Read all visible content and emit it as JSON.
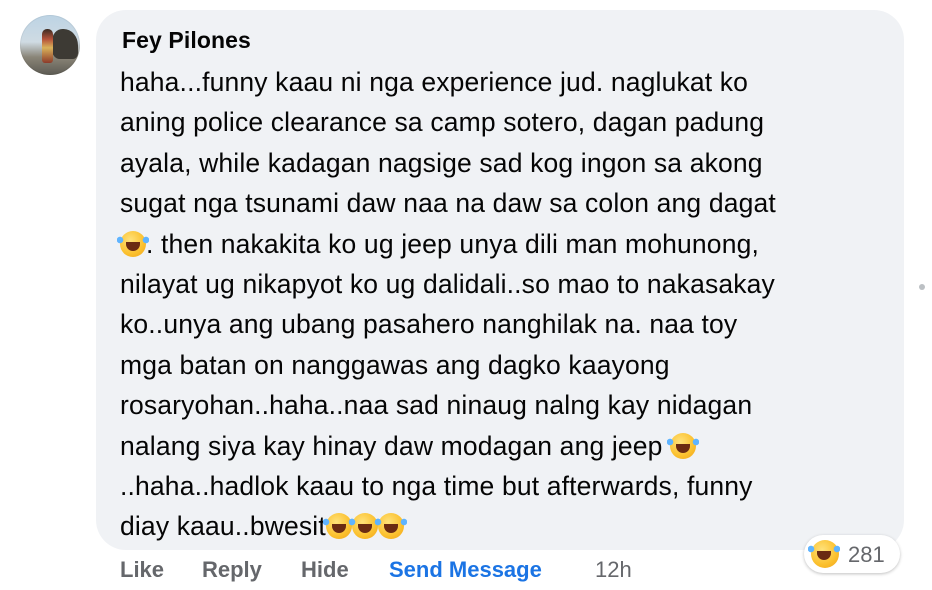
{
  "comment": {
    "author": "Fey Pilones",
    "lines": [
      "haha...funny kaau ni nga experience jud. naglukat ko",
      "aning police clearance sa camp sotero, dagan padung",
      "ayala, while kadagan nagsige sad kog ingon sa akong",
      "sugat nga tsunami daw naa na daw sa colon ang dagat",
      ". then nakakita ko ug jeep unya dili man mohunong,",
      "nilayat ug nikapyot ko ug dalidali..so mao to nakasakay",
      "ko..unya ang ubang pasahero nanghilak na. naa toy",
      "mga batan on nanggawas ang dagko kaayong",
      "rosaryohan..haha..naa sad ninaug nalng kay nidagan",
      "nalang siya kay hinay daw modagan ang jeep",
      "..haha..hadlok kaau to nga time but afterwards, funny",
      "diay kaau..bwesit"
    ],
    "emoji": "face-with-tears-of-joy-icon"
  },
  "reactions": {
    "count": "281",
    "icon": "haha-reaction-icon"
  },
  "actions": {
    "like": "Like",
    "reply": "Reply",
    "hide": "Hide",
    "send_message": "Send Message",
    "timestamp": "12h"
  },
  "colors": {
    "bubble": "#f0f2f5",
    "text": "#050505",
    "secondary": "#65676b",
    "link": "#1b74e4"
  }
}
